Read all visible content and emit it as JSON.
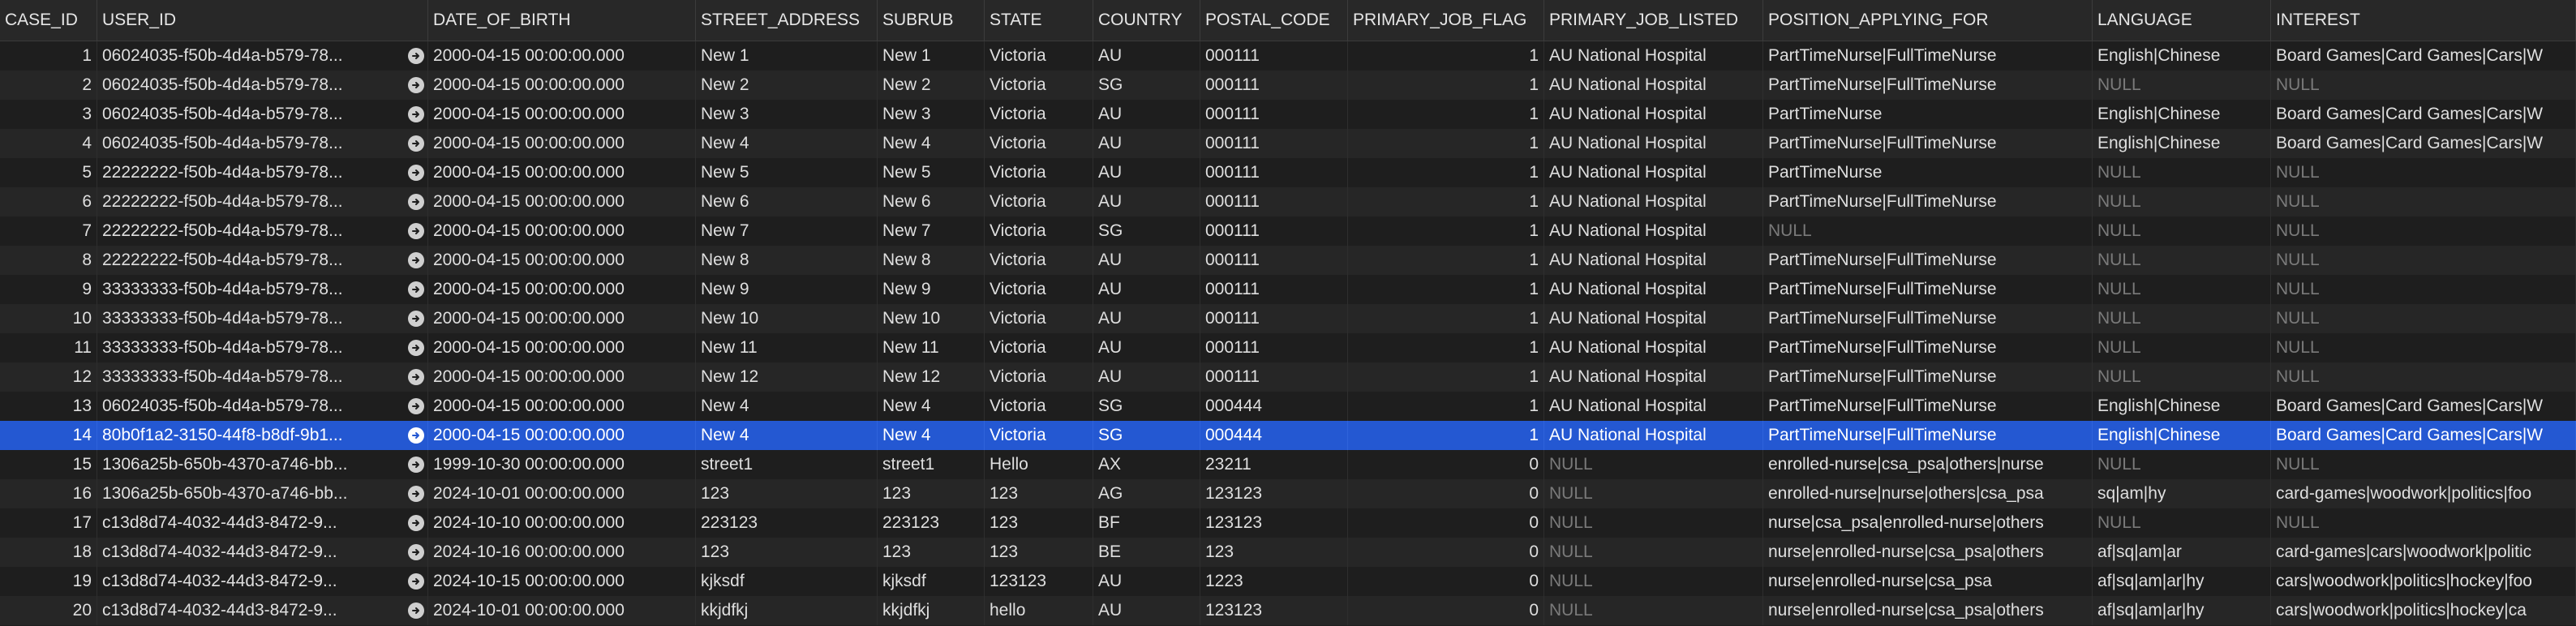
{
  "columns": [
    "CASE_ID",
    "USER_ID",
    "DATE_OF_BIRTH",
    "STREET_ADDRESS",
    "SUBRUB",
    "STATE",
    "COUNTRY",
    "POSTAL_CODE",
    "PRIMARY_JOB_FLAG",
    "PRIMARY_JOB_LISTED",
    "POSITION_APPLYING_FOR",
    "LANGUAGE",
    "INTEREST"
  ],
  "selected_row": 13,
  "rows": [
    [
      "1",
      "06024035-f50b-4d4a-b579-78...",
      "2000-04-15 00:00:00.000",
      "New 1",
      "New 1",
      "Victoria",
      "AU",
      "000111",
      "1",
      "AU National Hospital",
      "PartTimeNurse|FullTimeNurse",
      "English|Chinese",
      "Board Games|Card Games|Cars|W"
    ],
    [
      "2",
      "06024035-f50b-4d4a-b579-78...",
      "2000-04-15 00:00:00.000",
      "New 2",
      "New 2",
      "Victoria",
      "SG",
      "000111",
      "1",
      "AU National Hospital",
      "PartTimeNurse|FullTimeNurse",
      "NULL",
      "NULL"
    ],
    [
      "3",
      "06024035-f50b-4d4a-b579-78...",
      "2000-04-15 00:00:00.000",
      "New 3",
      "New 3",
      "Victoria",
      "AU",
      "000111",
      "1",
      "AU National Hospital",
      "PartTimeNurse",
      "English|Chinese",
      "Board Games|Card Games|Cars|W"
    ],
    [
      "4",
      "06024035-f50b-4d4a-b579-78...",
      "2000-04-15 00:00:00.000",
      "New 4",
      "New 4",
      "Victoria",
      "AU",
      "000111",
      "1",
      "AU National Hospital",
      "PartTimeNurse|FullTimeNurse",
      "English|Chinese",
      "Board Games|Card Games|Cars|W"
    ],
    [
      "5",
      "22222222-f50b-4d4a-b579-78...",
      "2000-04-15 00:00:00.000",
      "New 5",
      "New 5",
      "Victoria",
      "AU",
      "000111",
      "1",
      "AU National Hospital",
      "PartTimeNurse",
      "NULL",
      "NULL"
    ],
    [
      "6",
      "22222222-f50b-4d4a-b579-78...",
      "2000-04-15 00:00:00.000",
      "New 6",
      "New 6",
      "Victoria",
      "AU",
      "000111",
      "1",
      "AU National Hospital",
      "PartTimeNurse|FullTimeNurse",
      "NULL",
      "NULL"
    ],
    [
      "7",
      "22222222-f50b-4d4a-b579-78...",
      "2000-04-15 00:00:00.000",
      "New 7",
      "New 7",
      "Victoria",
      "SG",
      "000111",
      "1",
      "AU National Hospital",
      "NULL",
      "NULL",
      "NULL"
    ],
    [
      "8",
      "22222222-f50b-4d4a-b579-78...",
      "2000-04-15 00:00:00.000",
      "New 8",
      "New 8",
      "Victoria",
      "AU",
      "000111",
      "1",
      "AU National Hospital",
      "PartTimeNurse|FullTimeNurse",
      "NULL",
      "NULL"
    ],
    [
      "9",
      "33333333-f50b-4d4a-b579-78...",
      "2000-04-15 00:00:00.000",
      "New 9",
      "New 9",
      "Victoria",
      "AU",
      "000111",
      "1",
      "AU National Hospital",
      "PartTimeNurse|FullTimeNurse",
      "NULL",
      "NULL"
    ],
    [
      "10",
      "33333333-f50b-4d4a-b579-78...",
      "2000-04-15 00:00:00.000",
      "New 10",
      "New 10",
      "Victoria",
      "AU",
      "000111",
      "1",
      "AU National Hospital",
      "PartTimeNurse|FullTimeNurse",
      "NULL",
      "NULL"
    ],
    [
      "11",
      "33333333-f50b-4d4a-b579-78...",
      "2000-04-15 00:00:00.000",
      "New 11",
      "New 11",
      "Victoria",
      "AU",
      "000111",
      "1",
      "AU National Hospital",
      "PartTimeNurse|FullTimeNurse",
      "NULL",
      "NULL"
    ],
    [
      "12",
      "33333333-f50b-4d4a-b579-78...",
      "2000-04-15 00:00:00.000",
      "New 12",
      "New 12",
      "Victoria",
      "AU",
      "000111",
      "1",
      "AU National Hospital",
      "PartTimeNurse|FullTimeNurse",
      "NULL",
      "NULL"
    ],
    [
      "13",
      "06024035-f50b-4d4a-b579-78...",
      "2000-04-15 00:00:00.000",
      "New 4",
      "New 4",
      "Victoria",
      "SG",
      "000444",
      "1",
      "AU National Hospital",
      "PartTimeNurse|FullTimeNurse",
      "English|Chinese",
      "Board Games|Card Games|Cars|W"
    ],
    [
      "14",
      "80b0f1a2-3150-44f8-b8df-9b1...",
      "2000-04-15 00:00:00.000",
      "New 4",
      "New 4",
      "Victoria",
      "SG",
      "000444",
      "1",
      "AU National Hospital",
      "PartTimeNurse|FullTimeNurse",
      "English|Chinese",
      "Board Games|Card Games|Cars|W"
    ],
    [
      "15",
      "1306a25b-650b-4370-a746-bb...",
      "1999-10-30 00:00:00.000",
      "street1",
      "street1",
      "Hello",
      "AX",
      "23211",
      "0",
      "NULL",
      "enrolled-nurse|csa_psa|others|nurse",
      "NULL",
      "NULL"
    ],
    [
      "16",
      "1306a25b-650b-4370-a746-bb...",
      "2024-10-01 00:00:00.000",
      "123",
      "123",
      "123",
      "AG",
      "123123",
      "0",
      "NULL",
      "enrolled-nurse|nurse|others|csa_psa",
      "sq|am|hy",
      "card-games|woodwork|politics|foo"
    ],
    [
      "17",
      "c13d8d74-4032-44d3-8472-9...",
      "2024-10-10 00:00:00.000",
      "223123",
      "223123",
      "123",
      "BF",
      "123123",
      "0",
      "NULL",
      "nurse|csa_psa|enrolled-nurse|others",
      "NULL",
      "NULL"
    ],
    [
      "18",
      "c13d8d74-4032-44d3-8472-9...",
      "2024-10-16 00:00:00.000",
      "123",
      "123",
      "123",
      "BE",
      "123",
      "0",
      "NULL",
      "nurse|enrolled-nurse|csa_psa|others",
      "af|sq|am|ar",
      "card-games|cars|woodwork|politic"
    ],
    [
      "19",
      "c13d8d74-4032-44d3-8472-9...",
      "2024-10-15 00:00:00.000",
      "kjksdf",
      "kjksdf",
      "123123",
      "AU",
      "1223",
      "0",
      "NULL",
      "nurse|enrolled-nurse|csa_psa",
      "af|sq|am|ar|hy",
      "cars|woodwork|politics|hockey|foo"
    ],
    [
      "20",
      "c13d8d74-4032-44d3-8472-9...",
      "2024-10-01 00:00:00.000",
      "kkjdfkj",
      "kkjdfkj",
      "hello",
      "AU",
      "123123",
      "0",
      "NULL",
      "nurse|enrolled-nurse|csa_psa|others",
      "af|sq|am|ar|hy",
      "cars|woodwork|politics|hockey|ca"
    ]
  ]
}
